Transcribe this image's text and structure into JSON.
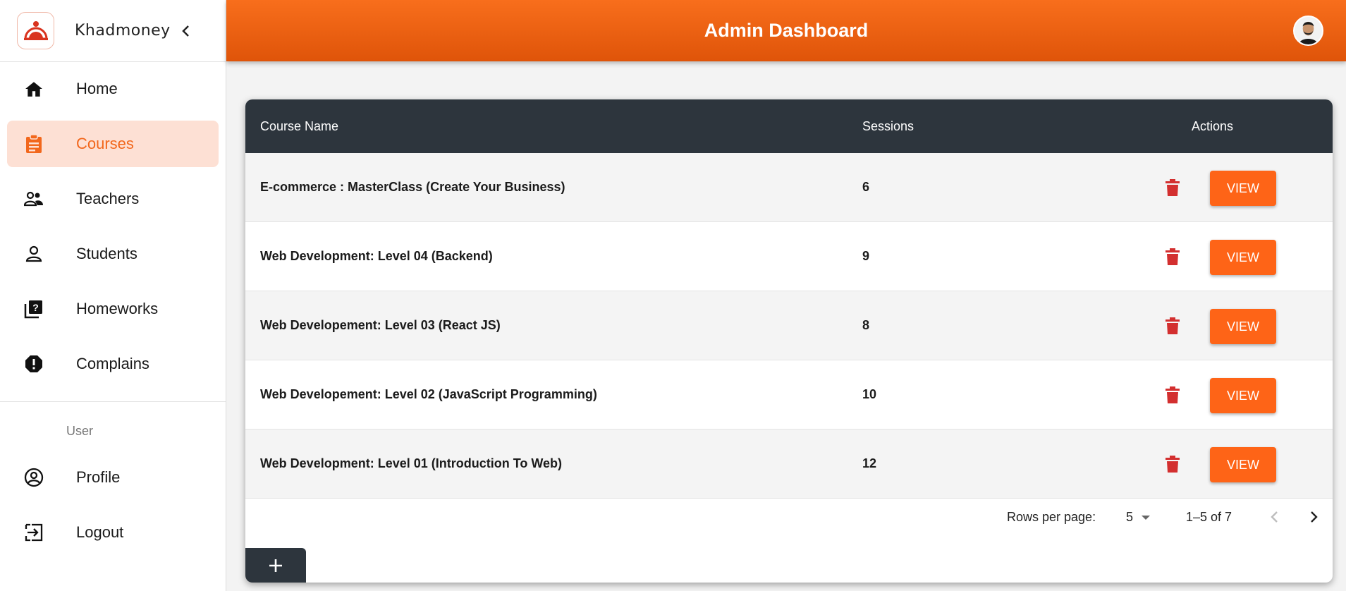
{
  "app": {
    "name": "Khadmoney"
  },
  "header": {
    "title": "Admin Dashboard"
  },
  "sidebar": {
    "items": [
      {
        "label": "Home",
        "icon": "home-icon"
      },
      {
        "label": "Courses",
        "icon": "clipboard-icon",
        "active": true
      },
      {
        "label": "Teachers",
        "icon": "people-icon"
      },
      {
        "label": "Students",
        "icon": "person-icon"
      },
      {
        "label": "Homeworks",
        "icon": "quiz-icon"
      },
      {
        "label": "Complains",
        "icon": "report-icon"
      }
    ],
    "section_label": "User",
    "bottom_items": [
      {
        "label": "Profile",
        "icon": "account-circle-icon"
      },
      {
        "label": "Logout",
        "icon": "logout-icon"
      }
    ]
  },
  "table": {
    "columns": [
      "Course Name",
      "Sessions",
      "Actions"
    ],
    "rows": [
      {
        "name": "E-commerce : MasterClass (Create Your Business)",
        "sessions": "6"
      },
      {
        "name": "Web Development: Level 04 (Backend)",
        "sessions": "9"
      },
      {
        "name": "Web Developement: Level 03 (React JS)",
        "sessions": "8"
      },
      {
        "name": "Web Developement: Level 02 (JavaScript Programming)",
        "sessions": "10"
      },
      {
        "name": "Web Development: Level 01 (Introduction To Web)",
        "sessions": "12"
      }
    ],
    "view_label": "VIEW",
    "pagination": {
      "rows_per_page_label": "Rows per page:",
      "rows_per_page": "5",
      "range": "1–5 of 7"
    }
  },
  "colors": {
    "accent": "#fe6417",
    "header_dark": "#2d353d",
    "active_bg": "#fde0d4",
    "delete": "#d32f2f"
  }
}
